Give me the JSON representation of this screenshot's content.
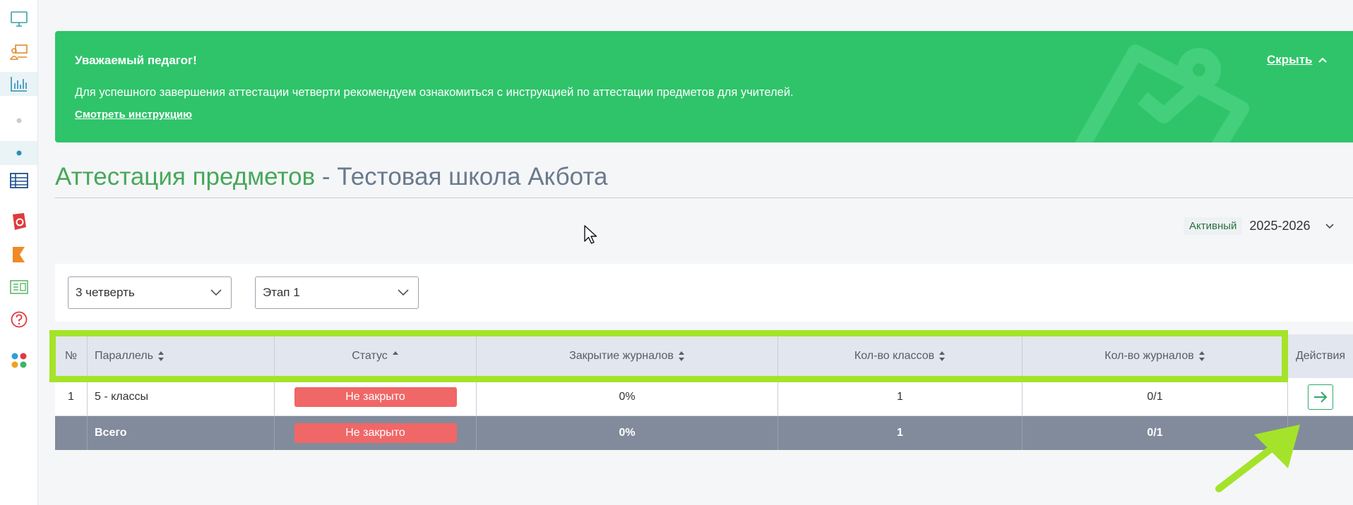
{
  "sidebar": {
    "items": [
      {
        "icon": "monitor-icon"
      },
      {
        "icon": "teacher-board-icon"
      },
      {
        "icon": "bar-chart-icon"
      },
      {
        "icon": "dot-icon"
      },
      {
        "icon": "dot-icon"
      },
      {
        "icon": "table-grid-icon"
      },
      {
        "icon": "app-logo-red-icon"
      },
      {
        "icon": "app-logo-orange-icon"
      },
      {
        "icon": "id-card-icon"
      },
      {
        "icon": "help-circle-icon"
      },
      {
        "icon": "apps-dots-icon"
      }
    ]
  },
  "banner": {
    "title": "Уважаемый педагог!",
    "text": "Для успешного завершения аттестации четверти рекомендуем ознакомиться с инструкцией по аттестации предметов для учителей.",
    "link": "Смотреть инструкцию",
    "hide_label": "Скрыть"
  },
  "page": {
    "title": "Аттестация предметов",
    "separator": " - ",
    "school": "Тестовая школа Акбота"
  },
  "year": {
    "badge": "Активный",
    "value": "2025-2026"
  },
  "filters": {
    "quarter": "3 четверть",
    "stage": "Этап 1"
  },
  "table": {
    "headers": {
      "num": "№",
      "parallel": "Параллель",
      "status": "Статус",
      "closing": "Закрытие журналов",
      "classes": "Кол-во классов",
      "journals": "Кол-во журналов",
      "actions": "Действия"
    },
    "rows": [
      {
        "num": "1",
        "parallel": "5 - классы",
        "status": "Не закрыто",
        "closing": "0%",
        "classes": "1",
        "journals": "0/1"
      }
    ],
    "total": {
      "label": "Всего",
      "status": "Не закрыто",
      "closing": "0%",
      "classes": "1",
      "journals": "0/1"
    }
  },
  "colors": {
    "banner": "#2fc46a",
    "title_green": "#46a85a",
    "status_red": "#f06767",
    "highlight": "#a4e32a",
    "total_row": "#828b9b"
  }
}
